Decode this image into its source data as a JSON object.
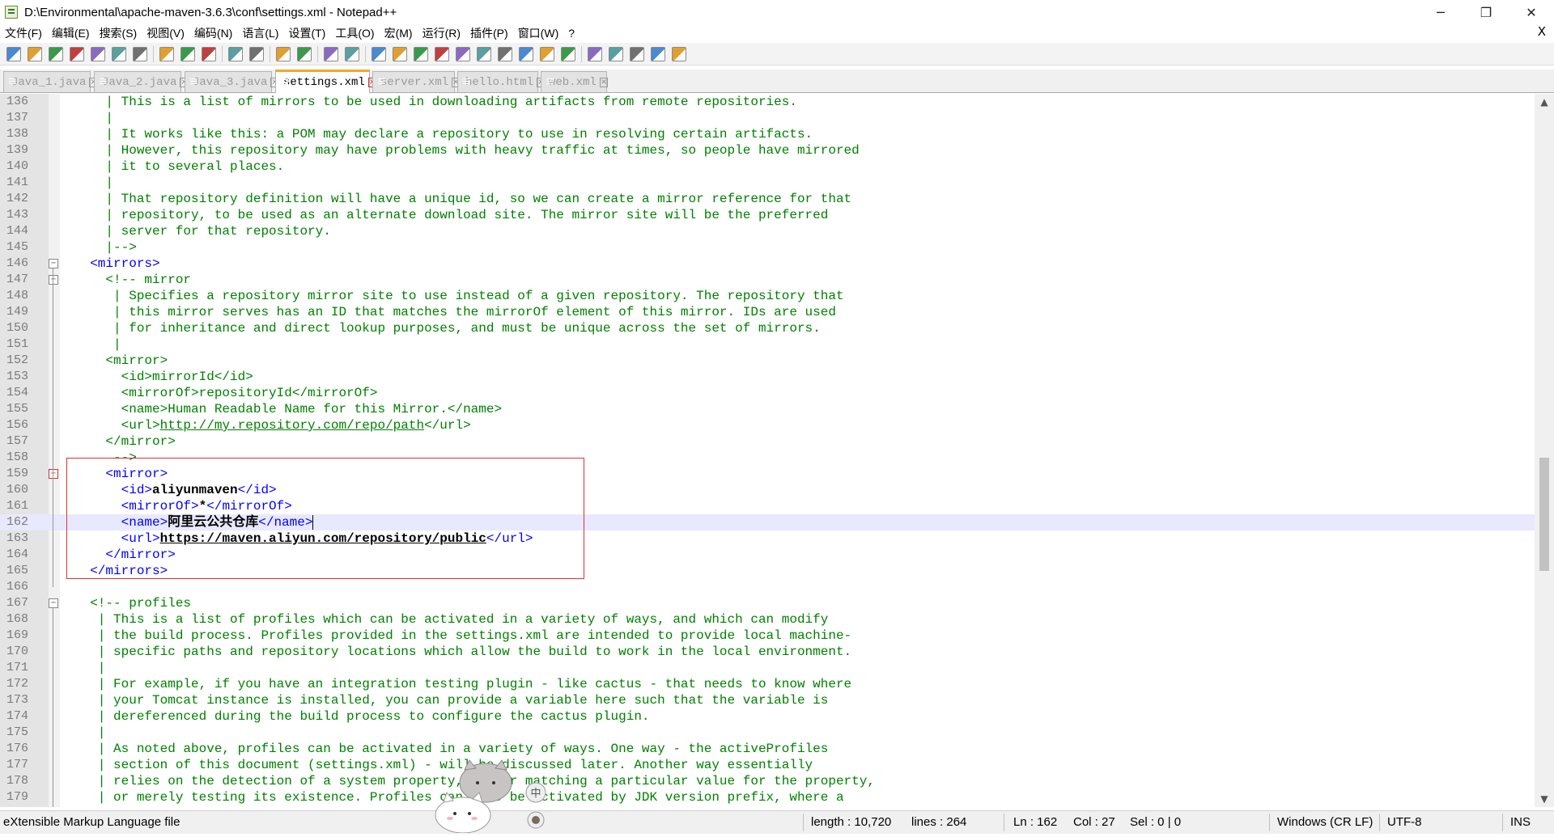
{
  "window": {
    "title": "D:\\Environmental\\apache-maven-3.6.3\\conf\\settings.xml - Notepad++",
    "minimize": "─",
    "restore": "❐",
    "close": "✕"
  },
  "menu": [
    "文件(F)",
    "编辑(E)",
    "搜索(S)",
    "视图(V)",
    "编码(N)",
    "语言(L)",
    "设置(T)",
    "工具(O)",
    "宏(M)",
    "运行(R)",
    "插件(P)",
    "窗口(W)",
    "?"
  ],
  "menu_close": "X",
  "toolbar_icons": [
    "new-file-icon",
    "open-file-icon",
    "save-icon",
    "save-all-icon",
    "close-icon",
    "close-all-icon",
    "print-icon",
    "sep",
    "cut-icon",
    "copy-icon",
    "paste-icon",
    "sep",
    "undo-icon",
    "redo-icon",
    "sep",
    "find-icon",
    "replace-icon",
    "sep",
    "zoom-in-icon",
    "zoom-out-icon",
    "sep",
    "sync-v-icon",
    "sync-h-icon",
    "word-wrap-icon",
    "show-all-chars-icon",
    "indent-guide-icon",
    "udl-icon",
    "doc-map-icon",
    "function-list-icon",
    "folder-workspace-icon",
    "monitoring-icon",
    "sep",
    "record-macro-icon",
    "stop-macro-icon",
    "play-macro-icon",
    "run-macro-multi-icon",
    "save-macro-icon"
  ],
  "tabs": [
    {
      "label": "Java_1.java",
      "active": false
    },
    {
      "label": "Java_2.java",
      "active": false
    },
    {
      "label": "Java_3.java",
      "active": false
    },
    {
      "label": "settings.xml",
      "active": true
    },
    {
      "label": "server.xml",
      "active": false
    },
    {
      "label": "hello.html",
      "active": false
    },
    {
      "label": "web.xml",
      "active": false
    }
  ],
  "editor": {
    "current_line": 162,
    "lines": [
      {
        "n": "136",
        "parts": [
          [
            "comment",
            "    | This is a list of mirrors to be used in downloading artifacts from remote repositories."
          ]
        ]
      },
      {
        "n": "137",
        "parts": [
          [
            "comment",
            "    |"
          ]
        ]
      },
      {
        "n": "138",
        "parts": [
          [
            "comment",
            "    | It works like this: a POM may declare a repository to use in resolving certain artifacts."
          ]
        ]
      },
      {
        "n": "139",
        "parts": [
          [
            "comment",
            "    | However, this repository may have problems with heavy traffic at times, so people have mirrored"
          ]
        ]
      },
      {
        "n": "140",
        "parts": [
          [
            "comment",
            "    | it to several places."
          ]
        ]
      },
      {
        "n": "141",
        "parts": [
          [
            "comment",
            "    |"
          ]
        ]
      },
      {
        "n": "142",
        "parts": [
          [
            "comment",
            "    | That repository definition will have a unique id, so we can create a mirror reference for that"
          ]
        ]
      },
      {
        "n": "143",
        "parts": [
          [
            "comment",
            "    | repository, to be used as an alternate download site. The mirror site will be the preferred"
          ]
        ]
      },
      {
        "n": "144",
        "parts": [
          [
            "comment",
            "    | server for that repository."
          ]
        ]
      },
      {
        "n": "145",
        "parts": [
          [
            "comment",
            "    |-->"
          ]
        ]
      },
      {
        "n": "146",
        "fold": "minus",
        "parts": [
          [
            "tag",
            "  <mirrors>"
          ]
        ]
      },
      {
        "n": "147",
        "fold": "minus",
        "parts": [
          [
            "comment",
            "    <!-- mirror"
          ]
        ]
      },
      {
        "n": "148",
        "parts": [
          [
            "comment",
            "     | Specifies a repository mirror site to use instead of a given repository. The repository that"
          ]
        ]
      },
      {
        "n": "149",
        "parts": [
          [
            "comment",
            "     | this mirror serves has an ID that matches the mirrorOf element of this mirror. IDs are used"
          ]
        ]
      },
      {
        "n": "150",
        "parts": [
          [
            "comment",
            "     | for inheritance and direct lookup purposes, and must be unique across the set of mirrors."
          ]
        ]
      },
      {
        "n": "151",
        "parts": [
          [
            "comment",
            "     |"
          ]
        ]
      },
      {
        "n": "152",
        "parts": [
          [
            "comment",
            "    <mirror>"
          ]
        ]
      },
      {
        "n": "153",
        "parts": [
          [
            "comment",
            "      <id>mirrorId</id>"
          ]
        ]
      },
      {
        "n": "154",
        "parts": [
          [
            "comment",
            "      <mirrorOf>repositoryId</mirrorOf>"
          ]
        ]
      },
      {
        "n": "155",
        "parts": [
          [
            "comment",
            "      <name>Human Readable Name for this Mirror.</name>"
          ]
        ]
      },
      {
        "n": "156",
        "parts": [
          [
            "comment",
            "      <url>"
          ],
          [
            "comment_u",
            "http://my.repository.com/repo/path"
          ],
          [
            "comment",
            "</url>"
          ]
        ]
      },
      {
        "n": "157",
        "parts": [
          [
            "comment",
            "    </mirror>"
          ]
        ]
      },
      {
        "n": "158",
        "parts": [
          [
            "comment",
            "     -->"
          ]
        ]
      },
      {
        "n": "159",
        "fold": "minus-red",
        "parts": [
          [
            "tag",
            "    <mirror>"
          ]
        ]
      },
      {
        "n": "160",
        "parts": [
          [
            "tag",
            "      <id>"
          ],
          [
            "bold",
            "aliyunmaven"
          ],
          [
            "tag",
            "</id>"
          ]
        ]
      },
      {
        "n": "161",
        "parts": [
          [
            "tag",
            "      <mirrorOf>"
          ],
          [
            "bold",
            "*"
          ],
          [
            "tag",
            "</mirrorOf>"
          ]
        ]
      },
      {
        "n": "162",
        "parts": [
          [
            "tag",
            "      <name>"
          ],
          [
            "bold",
            "阿里云公共仓库"
          ],
          [
            "tag",
            "</name>"
          ]
        ]
      },
      {
        "n": "163",
        "parts": [
          [
            "tag",
            "      <url>"
          ],
          [
            "bold_u",
            "https://maven.aliyun.com/repository/public"
          ],
          [
            "tag",
            "</url>"
          ]
        ]
      },
      {
        "n": "164",
        "parts": [
          [
            "tag",
            "    </mirror>"
          ]
        ]
      },
      {
        "n": "165",
        "parts": [
          [
            "tag",
            "  </mirrors>"
          ]
        ]
      },
      {
        "n": "166",
        "parts": []
      },
      {
        "n": "167",
        "fold": "minus",
        "parts": [
          [
            "comment",
            "  <!-- profiles"
          ]
        ]
      },
      {
        "n": "168",
        "parts": [
          [
            "comment",
            "   | This is a list of profiles which can be activated in a variety of ways, and which can modify"
          ]
        ]
      },
      {
        "n": "169",
        "parts": [
          [
            "comment",
            "   | the build process. Profiles provided in the settings.xml are intended to provide local machine-"
          ]
        ]
      },
      {
        "n": "170",
        "parts": [
          [
            "comment",
            "   | specific paths and repository locations which allow the build to work in the local environment."
          ]
        ]
      },
      {
        "n": "171",
        "parts": [
          [
            "comment",
            "   |"
          ]
        ]
      },
      {
        "n": "172",
        "parts": [
          [
            "comment",
            "   | For example, if you have an integration testing plugin - like cactus - that needs to know where"
          ]
        ]
      },
      {
        "n": "173",
        "parts": [
          [
            "comment",
            "   | your Tomcat instance is installed, you can provide a variable here such that the variable is"
          ]
        ]
      },
      {
        "n": "174",
        "parts": [
          [
            "comment",
            "   | dereferenced during the build process to configure the cactus plugin."
          ]
        ]
      },
      {
        "n": "175",
        "parts": [
          [
            "comment",
            "   |"
          ]
        ]
      },
      {
        "n": "176",
        "parts": [
          [
            "comment",
            "   | As noted above, profiles can be activated in a variety of ways. One way - the activeProfiles"
          ]
        ]
      },
      {
        "n": "177",
        "parts": [
          [
            "comment",
            "   | section of this document (settings.xml) - will be discussed later. Another way essentially"
          ]
        ]
      },
      {
        "n": "178",
        "parts": [
          [
            "comment",
            "   | relies on the detection of a system property, either matching a particular value for the property,"
          ]
        ]
      },
      {
        "n": "179",
        "parts": [
          [
            "comment",
            "   | or merely testing its existence. Profiles can also be activated by JDK version prefix, where a"
          ]
        ]
      }
    ]
  },
  "status": {
    "file_type": "eXtensible Markup Language file",
    "length": "length : 10,720",
    "lines": "lines : 264",
    "ln": "Ln : 162",
    "col": "Col : 27",
    "sel": "Sel : 0 | 0",
    "eol": "Windows (CR LF)",
    "encoding": "UTF-8",
    "mode": "INS"
  },
  "sticker_badge": "中"
}
